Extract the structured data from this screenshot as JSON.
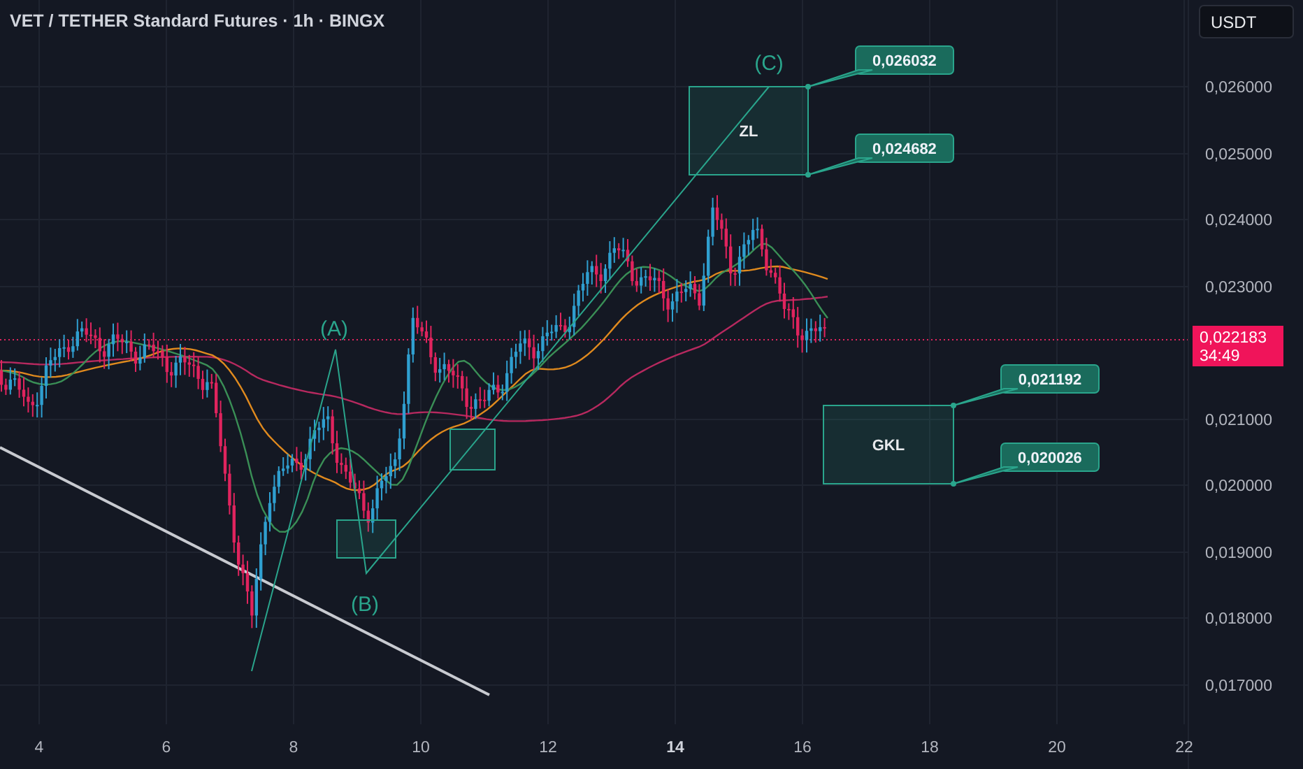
{
  "title": "VET / TETHER Standard Futures · 1h · BINGX",
  "currency_button": "USDT",
  "price_axis": [
    "0,026000",
    "0,025000",
    "0,024000",
    "0,023000",
    "0,021000",
    "0,020000",
    "0,019000",
    "0,018000",
    "0,017000"
  ],
  "current_price": {
    "price": "0,022183",
    "countdown": "34:49"
  },
  "time_axis": [
    {
      "label": "4",
      "emphasized": false
    },
    {
      "label": "6",
      "emphasized": false
    },
    {
      "label": "8",
      "emphasized": false
    },
    {
      "label": "10",
      "emphasized": false
    },
    {
      "label": "12",
      "emphasized": false
    },
    {
      "label": "14",
      "emphasized": true
    },
    {
      "label": "16",
      "emphasized": false
    },
    {
      "label": "18",
      "emphasized": false
    },
    {
      "label": "20",
      "emphasized": false
    },
    {
      "label": "22",
      "emphasized": false
    }
  ],
  "wave_labels": [
    "(A)",
    "(B)",
    "(C)"
  ],
  "zones": [
    {
      "label": "ZL",
      "upper": "0,026032",
      "lower": "0,024682"
    },
    {
      "label": "GKL",
      "upper": "0,021192",
      "lower": "0,020026"
    }
  ]
}
